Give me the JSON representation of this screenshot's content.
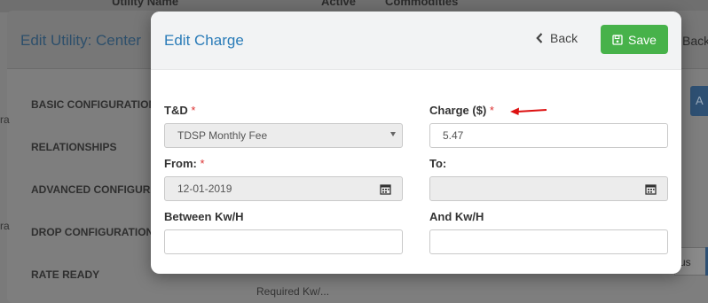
{
  "background": {
    "table_headers": [
      "Utility Name",
      "Active",
      "Commodities"
    ],
    "modal_title": "Edit Utility: Center",
    "back_label": "Back",
    "nav_items": [
      "BASIC CONFIGURATION",
      "RELATIONSHIPS",
      "ADVANCED CONFIGURA",
      "DROP CONFIGURATION",
      "RATE READY"
    ],
    "right_button_text": "A",
    "right_pill_text": "us",
    "bottom_label": "Required Kw/..."
  },
  "modal": {
    "title": "Edit Charge",
    "back_label": "Back",
    "save_label": "Save",
    "colors": {
      "title": "#2b7cb8",
      "save": "#47b24a",
      "required": "#d33"
    }
  },
  "form": {
    "td": {
      "label": "T&D",
      "required_mark": "*",
      "value": "TDSP Monthly Fee"
    },
    "charge": {
      "label": "Charge ($)",
      "required_mark": "*",
      "value": "5.47"
    },
    "from": {
      "label": "From:",
      "required_mark": "*",
      "value": "12-01-2019"
    },
    "to": {
      "label": "To:",
      "value": ""
    },
    "between": {
      "label": "Between Kw/H",
      "value": ""
    },
    "and": {
      "label": "And Kw/H",
      "value": ""
    }
  }
}
